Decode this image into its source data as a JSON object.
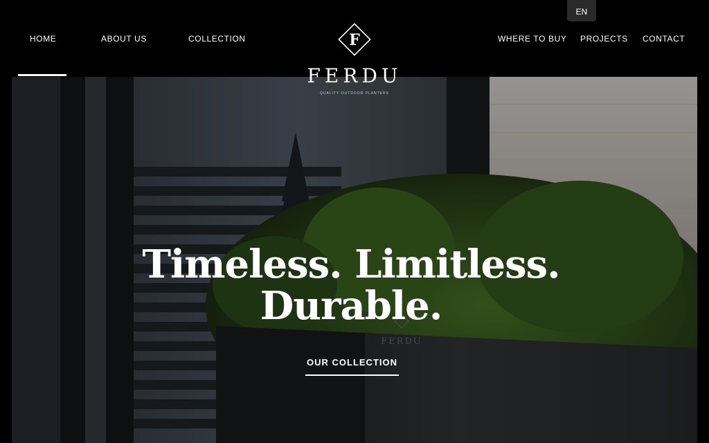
{
  "header": {
    "nav_left": [
      "HOME",
      "ABOUT US",
      "COLLECTION"
    ],
    "nav_right": [
      "WHERE TO BUY",
      "PROJECTS",
      "CONTACT"
    ],
    "language": "EN",
    "logo": {
      "letter": "F",
      "wordmark": "FERDU",
      "tagline": "QUALITY OUTDOOR PLANTERS"
    }
  },
  "hero": {
    "headline_line1": "Timeless. Limitless.",
    "headline_line2": "Durable.",
    "cta_label": "OUR COLLECTION",
    "planter_brand": "FERDU"
  },
  "colors": {
    "header_bg": "#000000",
    "text": "#ffffff",
    "lang_bg": "#2a2a2a"
  }
}
